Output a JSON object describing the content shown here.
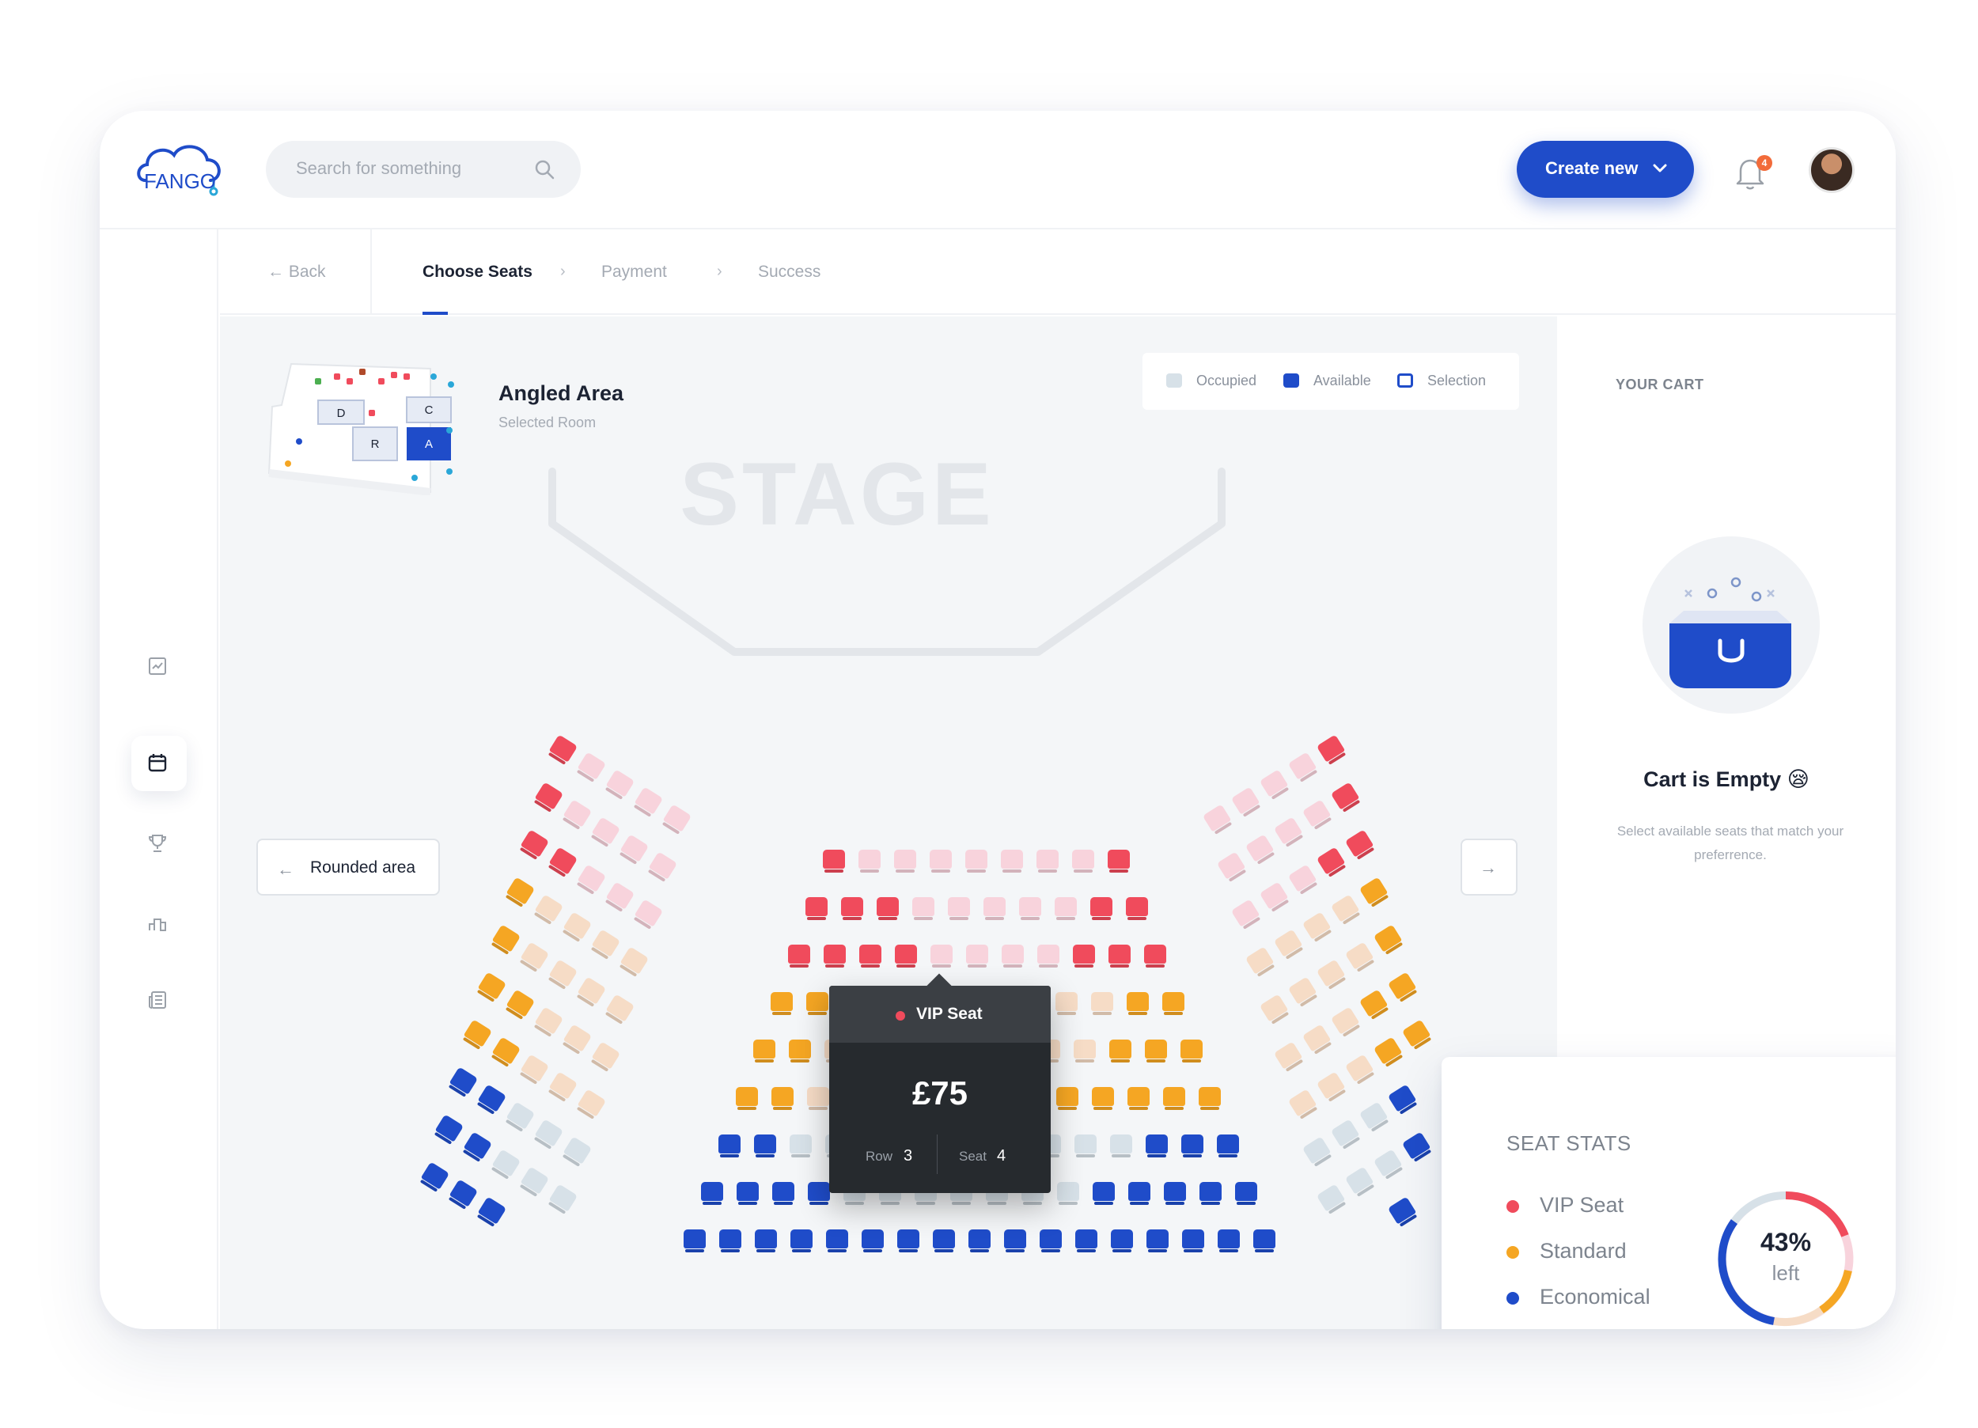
{
  "header": {
    "logo_text": "FANGO",
    "search_placeholder": "Search for something",
    "create_label": "Create new",
    "notification_count": "4"
  },
  "breadcrumb": {
    "back": "Back",
    "steps": [
      "Choose Seats",
      "Payment",
      "Success"
    ]
  },
  "room": {
    "title": "Angled Area",
    "subtitle": "Selected Room",
    "minimap_labels": [
      "D",
      "C",
      "R",
      "A"
    ]
  },
  "legend": [
    {
      "label": "Occupied",
      "color": "#d7e1e8"
    },
    {
      "label": "Available",
      "color": "#1f4cc9"
    },
    {
      "label": "Selection",
      "color": "#1f4cc9"
    }
  ],
  "stage_label": "STAGE",
  "nav": {
    "left_area": "Rounded area"
  },
  "tooltip": {
    "title": "VIP Seat",
    "price": "£75",
    "row_label": "Row",
    "row_value": "3",
    "seat_label": "Seat",
    "seat_value": "4"
  },
  "cart": {
    "title": "YOUR CART",
    "empty_title": "Cart is Empty 😪",
    "empty_desc": "Select available seats that match your preferrence."
  },
  "seat_stats": {
    "title": "SEAT STATS",
    "categories": [
      {
        "label": "VIP Seat",
        "color": "#f04b5c"
      },
      {
        "label": "Standard",
        "color": "#f5a623"
      },
      {
        "label": "Economical",
        "color": "#1f4cc9"
      }
    ],
    "percent_left": "43%",
    "left_label": "left"
  },
  "colors": {
    "vip": "#f04b5c",
    "vip_occupied": "#f8d3dc",
    "standard": "#f5a623",
    "standard_occupied": "#f6dcc6",
    "economy": "#1f4cc9",
    "economy_occupied": "#d7e1e8",
    "accent": "#1f4cc9"
  }
}
